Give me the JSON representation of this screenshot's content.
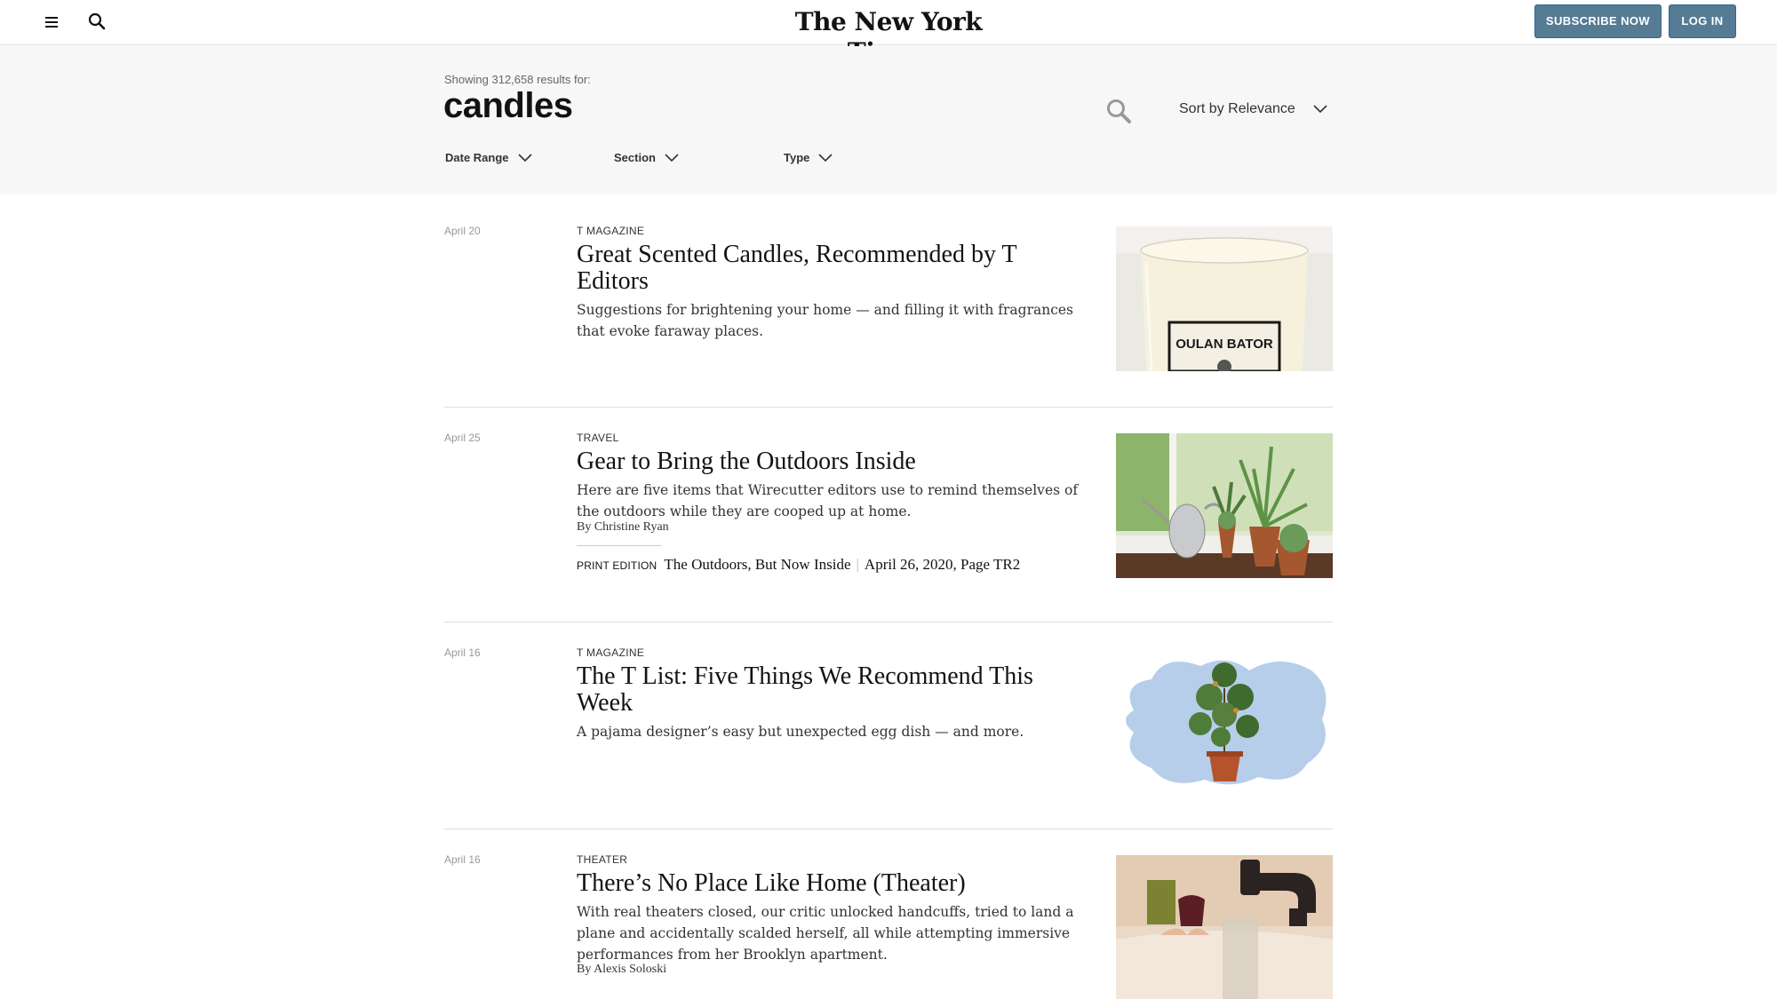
{
  "header": {
    "logo": "The New York Times",
    "subscribe_label": "SUBSCRIBE NOW",
    "login_label": "LOG IN",
    "brand_color": "#567b95"
  },
  "search": {
    "showing_text": "Showing 312,658 results for:",
    "query": "candles",
    "sort_label": "Sort by Relevance",
    "filters": {
      "date_range": "Date Range",
      "section": "Section",
      "type": "Type"
    }
  },
  "results": [
    {
      "date": "April 20",
      "kicker": "T Magazine",
      "title": "Great Scented Candles, Recommended by T Editors",
      "summary": "Suggestions for brightening your home — and filling it with fragrances that evoke faraway places.",
      "image_label": "OULAN BATOR"
    },
    {
      "date": "April 25",
      "kicker": "Travel",
      "title": "Gear to Bring the Outdoors Inside",
      "summary": "Here are five items that Wirecutter editors use to remind themselves of the outdoors while they are cooped up at home.",
      "byline": "By Christine Ryan",
      "print_label": "PRINT EDITION",
      "print_headline": "The Outdoors, But Now Inside",
      "print_info": "April 26, 2020, Page TR2"
    },
    {
      "date": "April 16",
      "kicker": "T Magazine",
      "title": "The T List: Five Things We Recommend This Week",
      "summary": "A pajama designer’s easy but unexpected egg dish — and more."
    },
    {
      "date": "April 16",
      "kicker": "Theater",
      "title": "There’s No Place Like Home (Theater)",
      "summary": "With real theaters closed, our critic unlocked handcuffs, tried to land a plane and accidentally scalded herself, all while attempting immersive performances from her Brooklyn apartment.",
      "byline": "By Alexis Soloski"
    }
  ]
}
